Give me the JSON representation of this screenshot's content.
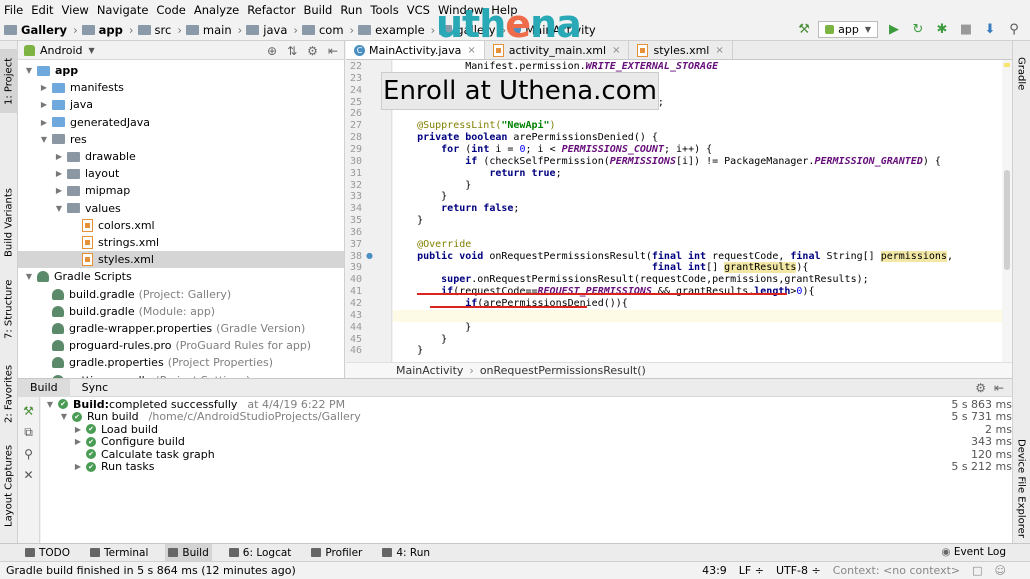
{
  "menu": [
    "File",
    "Edit",
    "View",
    "Navigate",
    "Code",
    "Analyze",
    "Refactor",
    "Build",
    "Run",
    "Tools",
    "VCS",
    "Window",
    "Help"
  ],
  "breadcrumb": [
    "Gallery",
    "app",
    "src",
    "main",
    "java",
    "com",
    "example",
    "gallery",
    "MainActivity"
  ],
  "run_config": "app",
  "left_strip": [
    "1: Project",
    "Build Variants",
    "7: Structure",
    "2: Favorites",
    "Layout Captures"
  ],
  "right_strip": [
    "Gradle",
    "Device File Explorer"
  ],
  "project": {
    "view": "Android",
    "tree": [
      {
        "label": "app",
        "depth": 0,
        "icon": "folder",
        "expanded": true
      },
      {
        "label": "manifests",
        "depth": 1,
        "icon": "folder",
        "expanded": false
      },
      {
        "label": "java",
        "depth": 1,
        "icon": "folder",
        "expanded": false
      },
      {
        "label": "generatedJava",
        "depth": 1,
        "icon": "folder",
        "expanded": false
      },
      {
        "label": "res",
        "depth": 1,
        "icon": "folder",
        "expanded": true
      },
      {
        "label": "drawable",
        "depth": 2,
        "icon": "folder",
        "expanded": false
      },
      {
        "label": "layout",
        "depth": 2,
        "icon": "folder",
        "expanded": false
      },
      {
        "label": "mipmap",
        "depth": 2,
        "icon": "folder",
        "expanded": false
      },
      {
        "label": "values",
        "depth": 2,
        "icon": "folder",
        "expanded": true
      },
      {
        "label": "colors.xml",
        "depth": 3,
        "icon": "xml"
      },
      {
        "label": "strings.xml",
        "depth": 3,
        "icon": "xml"
      },
      {
        "label": "styles.xml",
        "depth": 3,
        "icon": "xml",
        "selected": true
      },
      {
        "label": "Gradle Scripts",
        "depth": 0,
        "icon": "gradle",
        "expanded": true
      },
      {
        "label": "build.gradle",
        "hint": "(Project: Gallery)",
        "depth": 1,
        "icon": "gradle"
      },
      {
        "label": "build.gradle",
        "hint": "(Module: app)",
        "depth": 1,
        "icon": "gradle"
      },
      {
        "label": "gradle-wrapper.properties",
        "hint": "(Gradle Version)",
        "depth": 1,
        "icon": "gradle"
      },
      {
        "label": "proguard-rules.pro",
        "hint": "(ProGuard Rules for app)",
        "depth": 1,
        "icon": "gradle"
      },
      {
        "label": "gradle.properties",
        "hint": "(Project Properties)",
        "depth": 1,
        "icon": "gradle"
      },
      {
        "label": "settings.gradle",
        "hint": "(Project Settings)",
        "depth": 1,
        "icon": "gradle"
      }
    ]
  },
  "editor": {
    "tabs": [
      {
        "label": "MainActivity.java",
        "active": true
      },
      {
        "label": "activity_main.xml",
        "active": false
      },
      {
        "label": "styles.xml",
        "active": false
      }
    ],
    "lines": [
      {
        "n": "22",
        "segs": [
          [
            "",
            "            Manifest.permission."
          ],
          [
            "const",
            "WRITE_EXTERNAL_STORAGE"
          ]
        ]
      },
      {
        "n": "23",
        "segs": [
          [
            "",
            "    };"
          ]
        ]
      },
      {
        "n": "24",
        "segs": [
          [
            "",
            ""
          ]
        ]
      },
      {
        "n": "25",
        "segs": [
          [
            "",
            "                                         = 2;"
          ]
        ]
      },
      {
        "n": "26",
        "segs": [
          [
            "",
            ""
          ]
        ]
      },
      {
        "n": "27",
        "segs": [
          [
            "ann",
            "    @SuppressLint("
          ],
          [
            "str",
            "\"NewApi\""
          ],
          [
            "ann",
            ")"
          ]
        ]
      },
      {
        "n": "28",
        "segs": [
          [
            "kw",
            "    private boolean "
          ],
          [
            "",
            "arePermissionsDenied() {"
          ]
        ]
      },
      {
        "n": "29",
        "segs": [
          [
            "kw",
            "        for "
          ],
          [
            "",
            "("
          ],
          [
            "kw",
            "int "
          ],
          [
            "",
            "i = "
          ],
          [
            "num",
            "0"
          ],
          [
            "",
            "; i < "
          ],
          [
            "const",
            "PERMISSIONS_COUNT"
          ],
          [
            "",
            "; i++) {"
          ]
        ]
      },
      {
        "n": "30",
        "segs": [
          [
            "kw",
            "            if "
          ],
          [
            "",
            "(checkSelfPermission("
          ],
          [
            "const",
            "PERMISSIONS"
          ],
          [
            "",
            "[i]) != PackageManager."
          ],
          [
            "const",
            "PERMISSION_GRANTED"
          ],
          [
            "",
            ") {"
          ]
        ]
      },
      {
        "n": "31",
        "segs": [
          [
            "kw",
            "                return true"
          ],
          [
            "",
            ";"
          ]
        ]
      },
      {
        "n": "32",
        "segs": [
          [
            "",
            "            }"
          ]
        ]
      },
      {
        "n": "33",
        "segs": [
          [
            "",
            "        }"
          ]
        ]
      },
      {
        "n": "34",
        "segs": [
          [
            "kw",
            "        return false"
          ],
          [
            "",
            ";"
          ]
        ]
      },
      {
        "n": "35",
        "segs": [
          [
            "",
            "    }"
          ]
        ]
      },
      {
        "n": "36",
        "segs": [
          [
            "",
            ""
          ]
        ]
      },
      {
        "n": "37",
        "segs": [
          [
            "ann",
            "    @Override"
          ]
        ]
      },
      {
        "n": "38",
        "segs": [
          [
            "kw",
            "    public void "
          ],
          [
            "",
            "onRequestPermissionsResult("
          ],
          [
            "kw",
            "final int "
          ],
          [
            "",
            "requestCode, "
          ],
          [
            "kw",
            "final "
          ],
          [
            "",
            "String[] "
          ],
          [
            "param",
            "permissions"
          ],
          [
            "",
            ","
          ]
        ]
      },
      {
        "n": "39",
        "segs": [
          [
            "kw",
            "                                           final int"
          ],
          [
            "",
            "[] "
          ],
          [
            "param",
            "grantResults"
          ],
          [
            "",
            "){"
          ]
        ]
      },
      {
        "n": "40",
        "segs": [
          [
            "kw",
            "        super"
          ],
          [
            "",
            ".onRequestPermissionsResult(requestCode,permissions,grantResults);"
          ]
        ]
      },
      {
        "n": "41",
        "segs": [
          [
            "kw",
            "        if"
          ],
          [
            "",
            "(requestCode=="
          ],
          [
            "const",
            "REQUEST_PERMISSIONS"
          ],
          [
            "",
            " && grantResults."
          ],
          [
            "kw",
            "length"
          ],
          [
            "",
            ">"
          ],
          [
            "num",
            "0"
          ],
          [
            "",
            "){"
          ]
        ]
      },
      {
        "n": "42",
        "segs": [
          [
            "kw",
            "            if"
          ],
          [
            "",
            "(arePermissionsDenied()){"
          ]
        ]
      },
      {
        "n": "43",
        "segs": [
          [
            "",
            ""
          ]
        ],
        "current": true
      },
      {
        "n": "44",
        "segs": [
          [
            "",
            "            }"
          ]
        ]
      },
      {
        "n": "45",
        "segs": [
          [
            "",
            "        }"
          ]
        ]
      },
      {
        "n": "46",
        "segs": [
          [
            "",
            "    }"
          ]
        ]
      }
    ],
    "breadcrumb": [
      "MainActivity",
      "onRequestPermissionsResult()"
    ]
  },
  "build": {
    "tabs": [
      "Build",
      "Sync"
    ],
    "rows": [
      {
        "depth": 0,
        "label": "Build:",
        "bold_label": true,
        "rest": " completed successfully",
        "extra": "at 4/4/19 6:22 PM",
        "time": "5 s 863 ms",
        "expanded": true
      },
      {
        "depth": 1,
        "label": "Run build",
        "rest": "",
        "extra": "/home/c/AndroidStudioProjects/Gallery",
        "time": "5 s 731 ms",
        "expanded": true
      },
      {
        "depth": 2,
        "label": "Load build",
        "rest": "",
        "extra": "",
        "time": "2 ms",
        "expanded": false
      },
      {
        "depth": 2,
        "label": "Configure build",
        "rest": "",
        "extra": "",
        "time": "343 ms",
        "expanded": false
      },
      {
        "depth": 2,
        "label": "Calculate task graph",
        "rest": "",
        "extra": "",
        "time": "120 ms",
        "leaf": true
      },
      {
        "depth": 2,
        "label": "Run tasks",
        "rest": "",
        "extra": "",
        "time": "5 s 212 ms",
        "expanded": false
      }
    ]
  },
  "toolwindows": [
    {
      "label": "TODO",
      "active": false
    },
    {
      "label": "Terminal",
      "active": false
    },
    {
      "label": "Build",
      "active": true
    },
    {
      "label": "6: Logcat",
      "active": false
    },
    {
      "label": "Profiler",
      "active": false
    },
    {
      "label": "4: Run",
      "active": false
    }
  ],
  "event_log": "Event Log",
  "status": {
    "message": "Gradle build finished in 5 s 864 ms (12 minutes ago)",
    "position": "43:9",
    "line_sep": "LF ÷",
    "encoding": "UTF-8 ÷",
    "context": "Context: <no context>"
  },
  "overlay": {
    "logo_a": "uth",
    "logo_b": "e",
    "logo_c": "na",
    "banner": "Enroll at Uthena.com"
  }
}
